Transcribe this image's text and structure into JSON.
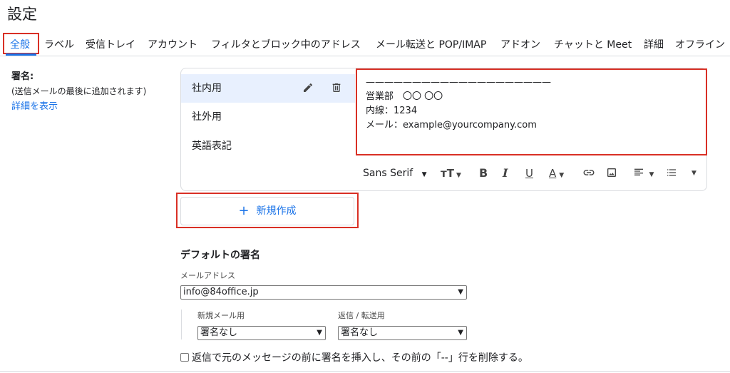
{
  "page_title": "設定",
  "tabs": [
    {
      "label": "全般",
      "active": true
    },
    {
      "label": "ラベル"
    },
    {
      "label": "受信トレイ"
    },
    {
      "label": "アカウント"
    },
    {
      "label": "フィルタとブロック中のアドレス"
    },
    {
      "label": "メール転送と POP/IMAP"
    },
    {
      "label": "アドオン"
    },
    {
      "label": "チャットと Meet"
    },
    {
      "label": "詳細"
    },
    {
      "label": "オフライン"
    }
  ],
  "signature_section": {
    "heading": "署名:",
    "hint": "(送信メールの最後に追加されます)",
    "details_link": "詳細を表示"
  },
  "signatures": [
    {
      "name": "社内用",
      "selected": true
    },
    {
      "name": "社外用"
    },
    {
      "name": "英語表記"
    }
  ],
  "editor": {
    "lines": [
      "————————————————————",
      "営業部　〇〇 〇〇",
      "内線：1234",
      "メール：example@yourcompany.com"
    ]
  },
  "toolbar": {
    "font": "Sans Serif",
    "icons": [
      "chevron-down-icon",
      "text-size-icon",
      "bold-icon",
      "italic-icon",
      "underline-icon",
      "text-color-icon",
      "link-icon",
      "image-icon",
      "align-icon",
      "list-icon",
      "more-icon"
    ]
  },
  "new_button": {
    "plus": "+",
    "label": "新規作成"
  },
  "default_signature": {
    "title": "デフォルトの署名",
    "email_label": "メールアドレス",
    "email_value": "info@84office.jp",
    "new_mail_label": "新規メール用",
    "new_mail_value": "署名なし",
    "reply_label": "返信 / 転送用",
    "reply_value": "署名なし",
    "checkbox_label": "返信で元のメッセージの前に署名を挿入し、その前の「--」行を削除する。"
  },
  "colors": {
    "accent": "#1a73e8",
    "highlight_red": "#d93025",
    "selected_bg": "#e8f0fe"
  }
}
